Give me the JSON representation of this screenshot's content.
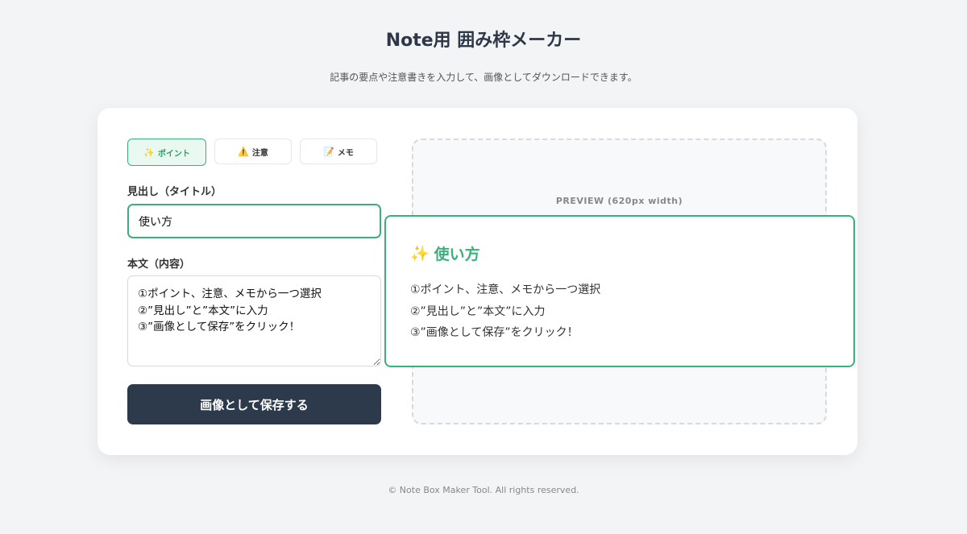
{
  "header": {
    "title": "Note用 囲み枠メーカー",
    "subtitle": "記事の要点や注意書きを入力して、画像としてダウンロードできます。"
  },
  "tabs": [
    {
      "icon": "sparkles-icon",
      "icon_glyph": "✨",
      "label": "ポイント",
      "active": true
    },
    {
      "icon": "warning-icon",
      "icon_glyph": "⚠️",
      "label": "注意",
      "active": false
    },
    {
      "icon": "memo-icon",
      "icon_glyph": "📝",
      "label": "メモ",
      "active": false
    }
  ],
  "form": {
    "title_label": "見出し（タイトル）",
    "title_value": "使い方",
    "body_label": "本文（内容）",
    "body_value": "①ポイント、注意、メモから一つ選択\n②”見出し”と”本文”に入力\n③”画像として保存”をクリック！",
    "save_label": "画像として保存する"
  },
  "preview": {
    "caption": "PREVIEW (620px width)",
    "icon_glyph": "✨",
    "title": "使い方",
    "body": "①ポイント、注意、メモから一つ選択\n②”見出し”と”本文”に入力\n③”画像として保存”をクリック！",
    "accent_color": "#38b27a"
  },
  "footer": {
    "text": "© Note Box Maker Tool. All rights reserved."
  }
}
